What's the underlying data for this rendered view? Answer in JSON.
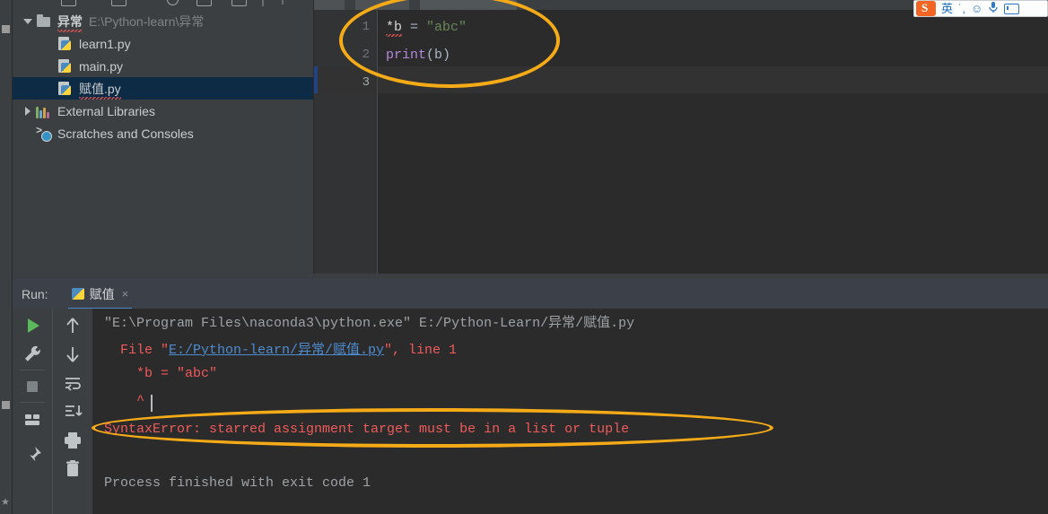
{
  "window": {
    "theme_bg": "#3c3f41",
    "editor_bg": "#2b2b2b",
    "accent_blue": "#4a88c7",
    "annotation_color": "#f5ab18",
    "error_color": "#f05a5a",
    "link_color": "#4e8cd0"
  },
  "sidebar_stripe": {
    "structure_label": "Structure",
    "structure_label_top": "S",
    "favorites_label": "Favorites"
  },
  "project_tree": {
    "nodes": [
      {
        "label": "异常",
        "sub": "E:\\Python-learn\\异常",
        "icon": "folder-icon",
        "arrow": "down",
        "indent": 0,
        "selected": false,
        "bold": true,
        "squiggle": true
      },
      {
        "label": "learn1.py",
        "sub": "",
        "icon": "python-file-icon",
        "arrow": "none",
        "indent": 1,
        "selected": false,
        "bold": false,
        "squiggle": false
      },
      {
        "label": "main.py",
        "sub": "",
        "icon": "python-file-icon",
        "arrow": "none",
        "indent": 1,
        "selected": false,
        "bold": false,
        "squiggle": false
      },
      {
        "label": "赋值.py",
        "sub": "",
        "icon": "python-file-icon",
        "arrow": "none",
        "indent": 1,
        "selected": true,
        "bold": false,
        "squiggle": true
      },
      {
        "label": "External Libraries",
        "sub": "",
        "icon": "libraries-icon",
        "arrow": "right",
        "indent": 0,
        "selected": false,
        "bold": false,
        "squiggle": false
      },
      {
        "label": "Scratches and Consoles",
        "sub": "",
        "icon": "scratches-icon",
        "arrow": "none",
        "indent": 0,
        "selected": false,
        "bold": false,
        "squiggle": false
      }
    ]
  },
  "editor": {
    "lines": [
      {
        "num": "1",
        "current": false
      },
      {
        "num": "2",
        "current": false
      },
      {
        "num": "3",
        "current": true
      }
    ],
    "code": {
      "line1": {
        "star_var": "*b",
        "operator": " = ",
        "string": "\"abc\""
      },
      "line2": {
        "fn": "print",
        "open": "(",
        "arg": "b",
        "close": ")"
      }
    },
    "annotation": "highlight-ellipse-code"
  },
  "run_panel": {
    "run_label": "Run:",
    "tab_name": "赋值",
    "tab_close": "×",
    "toolbar_buttons": [
      "rerun-button",
      "up-arrow-button",
      "settings-wrench-button",
      "down-arrow-button",
      "stop-button",
      "soft-wrap-button",
      "layout-button",
      "scroll-to-end-button",
      "pin-button",
      "print-button",
      "trash-button"
    ],
    "console": {
      "line_cmd": "\"E:\\Program Files\\naconda3\\python.exe\" E:/Python-Learn/异常/赋值.py",
      "line_file_prefix": "  File \"",
      "line_file_link": "E:/Python-learn/异常/赋值.py",
      "line_file_suffix": "\", line 1",
      "line_code": "    *b = \"abc\"",
      "line_caret": "    ^",
      "line_error": "SyntaxError: starred assignment target must be in a list or tuple",
      "line_exit": "Process finished with exit code 1"
    },
    "annotation": "highlight-ellipse-error"
  },
  "ime_toolbar": {
    "logo": "sogou-logo-icon",
    "mode": "英",
    "punctuation": "˙,",
    "emoji": "☺",
    "voice": "voice-icon",
    "keyboard": "keyboard-icon"
  }
}
